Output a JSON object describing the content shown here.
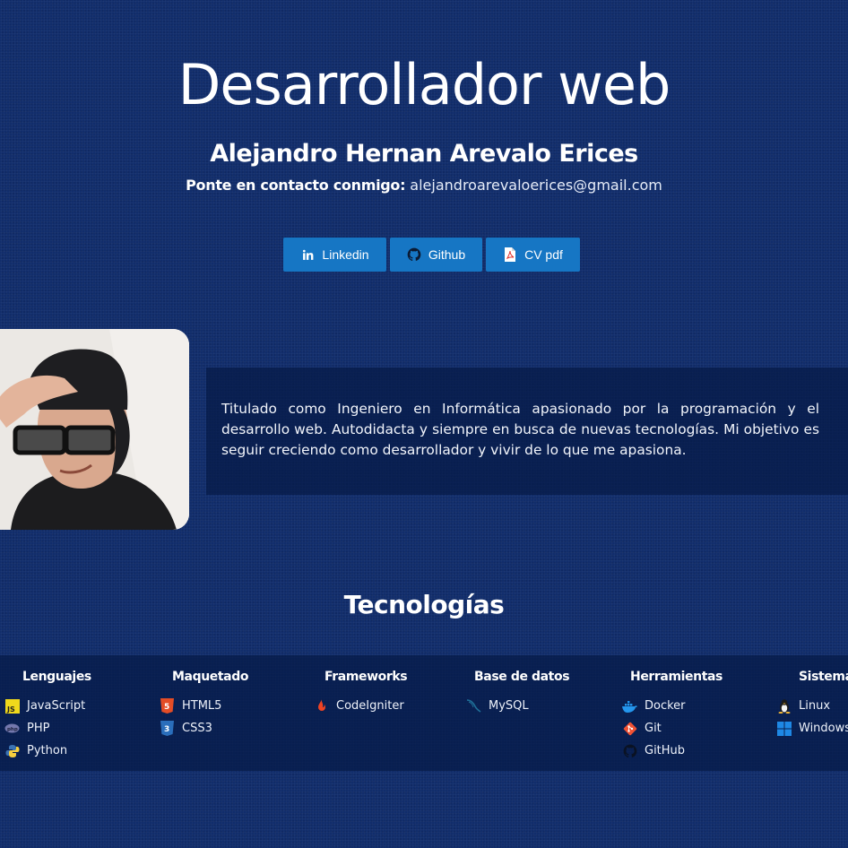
{
  "hero": {
    "title": "Desarrollador web",
    "name": "Alejandro Hernan Arevalo Erices",
    "contact_label": "Ponte en contacto conmigo:",
    "contact_email": "alejandroarevaloerices@gmail.com"
  },
  "social": {
    "linkedin": {
      "label": "Linkedin",
      "icon": "linkedin-icon"
    },
    "github": {
      "label": "Github",
      "icon": "github-icon"
    },
    "cv": {
      "label": "CV pdf",
      "icon": "pdf-icon"
    }
  },
  "about": {
    "text": "Titulado como Ingeniero en Informática apasionado por la programación y el desarrollo web. Autodidacta y siempre en busca de nuevas tecnologías. Mi objetivo es seguir creciendo como desarrollador y vivir de lo que me apasiona."
  },
  "technologies": {
    "title": "Tecnologías",
    "columns": [
      {
        "heading": "Lenguajes",
        "items": [
          {
            "label": "JavaScript",
            "icon": "javascript-icon"
          },
          {
            "label": "PHP",
            "icon": "php-icon"
          },
          {
            "label": "Python",
            "icon": "python-icon"
          }
        ]
      },
      {
        "heading": "Maquetado",
        "items": [
          {
            "label": "HTML5",
            "icon": "html5-icon"
          },
          {
            "label": "CSS3",
            "icon": "css3-icon"
          }
        ]
      },
      {
        "heading": "Frameworks",
        "items": [
          {
            "label": "CodeIgniter",
            "icon": "codeigniter-icon"
          }
        ]
      },
      {
        "heading": "Base de datos",
        "items": [
          {
            "label": "MySQL",
            "icon": "mysql-icon"
          }
        ]
      },
      {
        "heading": "Herramientas",
        "items": [
          {
            "label": "Docker",
            "icon": "docker-icon"
          },
          {
            "label": "Git",
            "icon": "git-icon"
          },
          {
            "label": "GitHub",
            "icon": "github-icon"
          }
        ]
      },
      {
        "heading": "Sistemas",
        "items": [
          {
            "label": "Linux",
            "icon": "linux-icon"
          },
          {
            "label": "Windows",
            "icon": "windows-icon"
          }
        ]
      }
    ]
  },
  "colors": {
    "background": "#112d6b",
    "button": "#1676c4",
    "card": "#061a46"
  }
}
